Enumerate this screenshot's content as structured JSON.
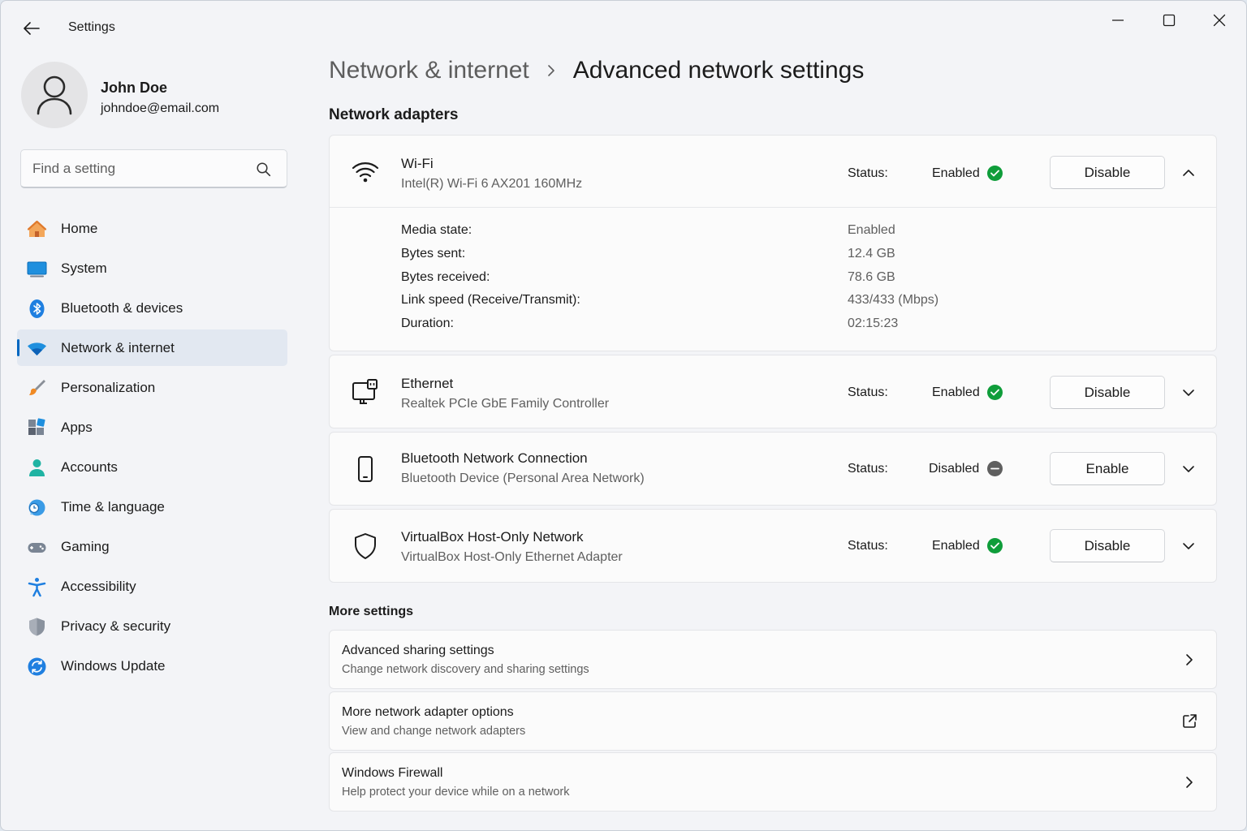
{
  "window": {
    "app_title": "Settings"
  },
  "profile": {
    "name": "John Doe",
    "email": "johndoe@email.com"
  },
  "search": {
    "placeholder": "Find a setting"
  },
  "sidebar": {
    "items": [
      {
        "label": "Home",
        "icon": "home-icon",
        "active": false
      },
      {
        "label": "System",
        "icon": "system-icon",
        "active": false
      },
      {
        "label": "Bluetooth & devices",
        "icon": "bluetooth-icon",
        "active": false
      },
      {
        "label": "Network & internet",
        "icon": "wifi-icon",
        "active": true
      },
      {
        "label": "Personalization",
        "icon": "brush-icon",
        "active": false
      },
      {
        "label": "Apps",
        "icon": "apps-icon",
        "active": false
      },
      {
        "label": "Accounts",
        "icon": "accounts-icon",
        "active": false
      },
      {
        "label": "Time & language",
        "icon": "globe-clock-icon",
        "active": false
      },
      {
        "label": "Gaming",
        "icon": "gamepad-icon",
        "active": false
      },
      {
        "label": "Accessibility",
        "icon": "accessibility-icon",
        "active": false
      },
      {
        "label": "Privacy & security",
        "icon": "shield-icon",
        "active": false
      },
      {
        "label": "Windows Update",
        "icon": "update-icon",
        "active": false
      }
    ]
  },
  "breadcrumb": {
    "parent": "Network & internet",
    "current": "Advanced network settings"
  },
  "adapters": {
    "section_title": "Network adapters",
    "status_label": "Status:",
    "items": [
      {
        "name": "Wi-Fi",
        "description": "Intel(R) Wi-Fi 6 AX201 160MHz",
        "status": "Enabled",
        "button": "Disable",
        "expanded": true,
        "icon": "wifi-icon",
        "details": [
          {
            "label": "Media state:",
            "value": "Enabled"
          },
          {
            "label": "Bytes sent:",
            "value": "12.4 GB"
          },
          {
            "label": "Bytes received:",
            "value": "78.6 GB"
          },
          {
            "label": "Link speed (Receive/Transmit):",
            "value": "433/433 (Mbps)"
          },
          {
            "label": "Duration:",
            "value": "02:15:23"
          }
        ]
      },
      {
        "name": "Ethernet",
        "description": "Realtek PCIe GbE Family Controller",
        "status": "Enabled",
        "button": "Disable",
        "expanded": false,
        "icon": "ethernet-icon"
      },
      {
        "name": "Bluetooth Network Connection",
        "description": "Bluetooth Device (Personal Area Network)",
        "status": "Disabled",
        "button": "Enable",
        "expanded": false,
        "icon": "phone-icon"
      },
      {
        "name": "VirtualBox Host-Only Network",
        "description": "VirtualBox Host-Only Ethernet Adapter",
        "status": "Enabled",
        "button": "Disable",
        "expanded": false,
        "icon": "shield-icon"
      }
    ]
  },
  "more_settings": {
    "section_title": "More settings",
    "items": [
      {
        "title": "Advanced sharing settings",
        "subtitle": "Change network discovery and sharing settings",
        "icon": "chevron-right-icon"
      },
      {
        "title": "More network adapter options",
        "subtitle": "View and change network adapters",
        "icon": "external-link-icon"
      },
      {
        "title": "Windows Firewall",
        "subtitle": "Help protect your device while on a network",
        "icon": "chevron-right-icon"
      }
    ]
  },
  "colors": {
    "accent": "#0067c0",
    "enabled": "#0f9d3a",
    "disabled": "#5f5f5f",
    "active_nav_bg": "#e2e8f1"
  }
}
